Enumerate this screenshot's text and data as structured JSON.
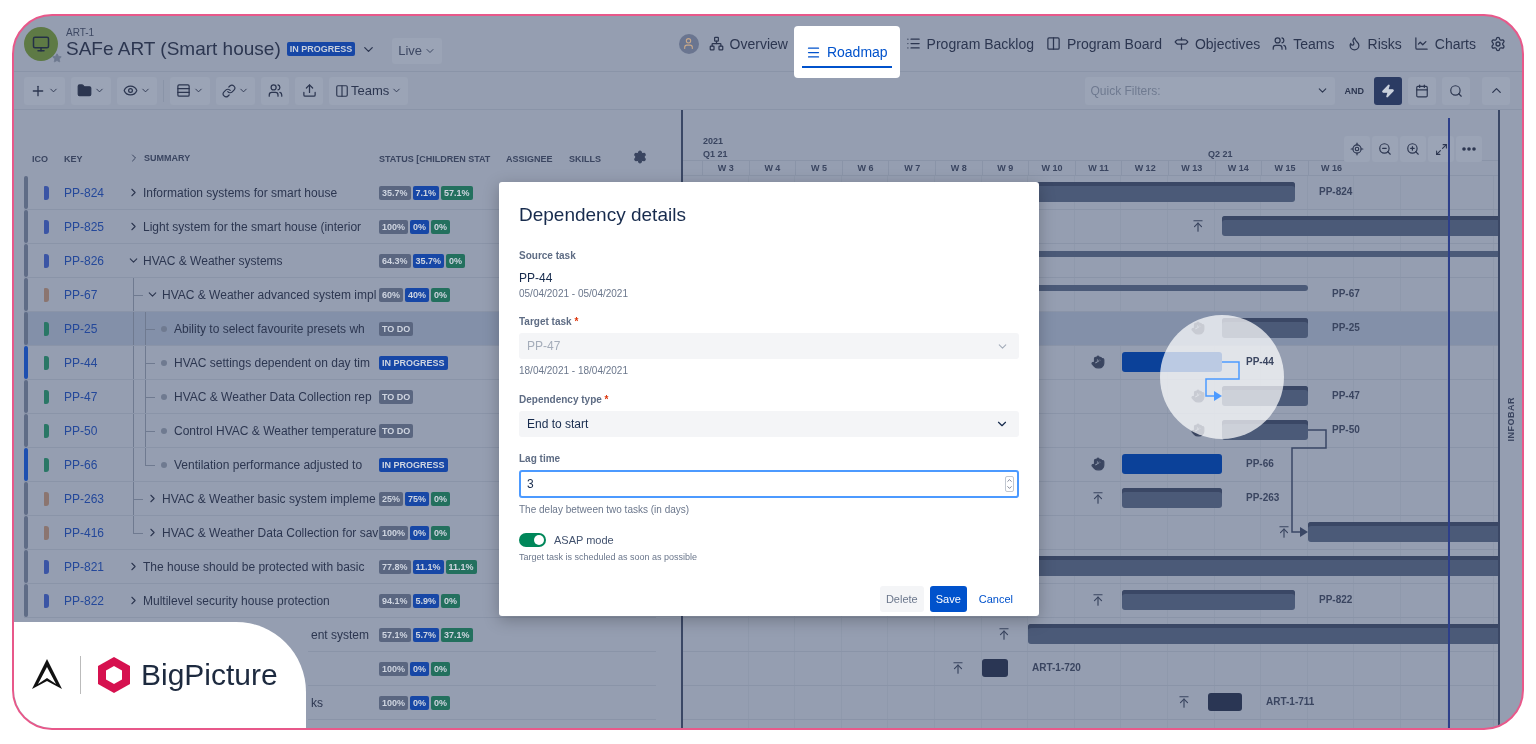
{
  "header": {
    "project_key": "ART-1",
    "title": "SAFe ART (Smart house)",
    "status": "IN PROGRESS",
    "view": "Live"
  },
  "nav": [
    {
      "label": "Overview",
      "selected": false
    },
    {
      "label": "Roadmap",
      "selected": true
    },
    {
      "label": "Program Backlog",
      "selected": false
    },
    {
      "label": "Program Board",
      "selected": false
    },
    {
      "label": "Objectives",
      "selected": false
    },
    {
      "label": "Teams",
      "selected": false
    },
    {
      "label": "Risks",
      "selected": false
    },
    {
      "label": "Charts",
      "selected": false
    }
  ],
  "toolbar": {
    "columns_button": "Teams",
    "quick_filters": {
      "placeholder": "Quick Filters:"
    },
    "operator": "AND",
    "lightning_active": true
  },
  "table": {
    "columns": [
      "ICO",
      "KEY",
      "SUMMARY",
      "STATUS [CHILDREN STAT",
      "ASSIGNEE",
      "SKILLS"
    ],
    "rows": [
      {
        "key": "PP-824",
        "summary": "Information systems for smart house",
        "color": "#3b55a5",
        "expanded": false,
        "selected": false,
        "status": [
          {
            "text": "35.7%",
            "kind": "todo"
          },
          {
            "text": "7.1%",
            "kind": "progress"
          },
          {
            "text": "57.1%",
            "kind": "done"
          }
        ],
        "bar": {
          "kind": "task",
          "label": "PP-824"
        }
      },
      {
        "key": "PP-825",
        "summary": "Light system for the smart house (interior",
        "color": "#3b55a5",
        "expanded": false,
        "selected": false,
        "status": [
          {
            "text": "100%",
            "kind": "todo"
          },
          {
            "text": "0%",
            "kind": "progress"
          },
          {
            "text": "0%",
            "kind": "done"
          }
        ],
        "bar": {
          "kind": "task",
          "marker": {
            "kind": "upload"
          }
        }
      },
      {
        "key": "PP-826",
        "summary": "HVAC & Weather systems",
        "color": "#3b55a5",
        "expanded": true,
        "selected": false,
        "status": [
          {
            "text": "64.3%",
            "kind": "todo"
          },
          {
            "text": "35.7%",
            "kind": "progress"
          },
          {
            "text": "0%",
            "kind": "done"
          }
        ],
        "bar": {
          "kind": "summary"
        },
        "children": [
          {
            "key": "PP-67",
            "summary": "HVAC & Weather advanced system impl",
            "color": "#8b7570",
            "expanded": true,
            "selected": false,
            "status": [
              {
                "text": "60%",
                "kind": "todo"
              },
              {
                "text": "40%",
                "kind": "progress"
              },
              {
                "text": "0%",
                "kind": "done"
              }
            ],
            "bar": {
              "kind": "summary",
              "label": "PP-67"
            },
            "children": [
              {
                "key": "PP-25",
                "summary": "Ability to select favourite presets wh",
                "color": "#2a7766",
                "selected": true,
                "status": [
                  {
                    "text": "TO DO",
                    "kind": "todo"
                  }
                ],
                "bar": {
                  "kind": "task",
                  "marker": {
                    "kind": "hand"
                  },
                  "label": "PP-25"
                }
              },
              {
                "key": "PP-44",
                "summary": "HVAC settings dependent on day tim",
                "color": "#2a7766",
                "selected": false,
                "status": [
                  {
                    "text": "IN PROGRESS",
                    "kind": "progress"
                  }
                ],
                "bar": {
                  "kind": "active",
                  "marker": {
                    "kind": "hand"
                  },
                  "label": "PP-44"
                }
              },
              {
                "key": "PP-47",
                "summary": "HVAC & Weather Data Collection rep",
                "color": "#2a7766",
                "selected": false,
                "status": [
                  {
                    "text": "TO DO",
                    "kind": "todo"
                  }
                ],
                "bar": {
                  "kind": "task",
                  "marker": {
                    "kind": "hand"
                  },
                  "label": "PP-47"
                }
              },
              {
                "key": "PP-50",
                "summary": "Control HVAC & Weather temperature",
                "color": "#2a7766",
                "selected": false,
                "status": [
                  {
                    "text": "TO DO",
                    "kind": "todo"
                  }
                ],
                "bar": {
                  "kind": "task",
                  "marker": {
                    "kind": "hand"
                  },
                  "label": "PP-50"
                }
              },
              {
                "key": "PP-66",
                "summary": "Ventilation performance adjusted to",
                "color": "#2a7766",
                "selected": false,
                "status": [
                  {
                    "text": "IN PROGRESS",
                    "kind": "progress"
                  }
                ],
                "bar": {
                  "kind": "active",
                  "marker": {
                    "kind": "hand"
                  },
                  "label": "PP-66"
                }
              }
            ]
          },
          {
            "key": "PP-263",
            "summary": "HVAC & Weather basic system impleme",
            "color": "#8b7570",
            "expanded": false,
            "selected": false,
            "status": [
              {
                "text": "25%",
                "kind": "todo"
              },
              {
                "text": "75%",
                "kind": "progress"
              },
              {
                "text": "0%",
                "kind": "done"
              }
            ],
            "bar": {
              "kind": "task",
              "marker": {
                "kind": "upload"
              },
              "label": "PP-263"
            }
          },
          {
            "key": "PP-416",
            "summary": "HVAC & Weather Data Collection for sav",
            "color": "#8b7570",
            "expanded": false,
            "selected": false,
            "status": [
              {
                "text": "100%",
                "kind": "todo"
              },
              {
                "text": "0%",
                "kind": "progress"
              },
              {
                "text": "0%",
                "kind": "done"
              }
            ],
            "bar": {
              "kind": "task",
              "marker": {
                "kind": "upload"
              }
            }
          }
        ]
      },
      {
        "key": "PP-821",
        "summary": "The house should be protected with basic",
        "color": "#3b55a5",
        "expanded": false,
        "selected": false,
        "status": [
          {
            "text": "77.8%",
            "kind": "todo"
          },
          {
            "text": "11.1%",
            "kind": "progress"
          },
          {
            "text": "11.1%",
            "kind": "done"
          }
        ],
        "bar": {
          "kind": "task"
        }
      },
      {
        "key": "PP-822",
        "summary": "Multilevel security house protection",
        "color": "#3b55a5",
        "expanded": false,
        "selected": false,
        "status": [
          {
            "text": "94.1%",
            "kind": "todo"
          },
          {
            "text": "5.9%",
            "kind": "progress"
          },
          {
            "text": "0%",
            "kind": "done"
          }
        ],
        "bar": {
          "kind": "task",
          "marker": {
            "kind": "upload"
          },
          "label": "PP-822"
        }
      },
      {
        "summary": "ent system",
        "selected": false,
        "status": [
          {
            "text": "57.1%",
            "kind": "todo"
          },
          {
            "text": "5.7%",
            "kind": "progress"
          },
          {
            "text": "37.1%",
            "kind": "done"
          }
        ],
        "bar": {
          "kind": "task",
          "marker": {
            "kind": "upload"
          }
        }
      },
      {
        "selected": false,
        "status": [
          {
            "text": "100%",
            "kind": "todo"
          },
          {
            "text": "0%",
            "kind": "progress"
          },
          {
            "text": "0%",
            "kind": "done"
          }
        ],
        "bar": {
          "kind": "compact",
          "marker": {
            "kind": "upload"
          },
          "label": "ART-1-720"
        }
      },
      {
        "summary": "ks",
        "selected": false,
        "status": [
          {
            "text": "100%",
            "kind": "todo"
          },
          {
            "text": "0%",
            "kind": "progress"
          },
          {
            "text": "0%",
            "kind": "done"
          }
        ],
        "bar": {
          "kind": "compact",
          "marker": {
            "kind": "upload"
          },
          "label": "ART-1-711"
        }
      }
    ]
  },
  "gantt": {
    "year": "2021",
    "quarters": [
      "Q1 21",
      "Q2 21"
    ],
    "weeks": [
      "W 3",
      "W 4",
      "W 5",
      "W 6",
      "W 7",
      "W 8",
      "W 9",
      "W 10",
      "W 11",
      "W 12",
      "W 13",
      "W 14",
      "W 15",
      "W 16"
    ]
  },
  "infobar": "INFOBAR",
  "dialog": {
    "title": "Dependency details",
    "source": {
      "label": "Source task",
      "key": "PP-44",
      "dates": "05/04/2021 - 05/04/2021"
    },
    "target": {
      "label": "Target task",
      "required_mark": "*",
      "value": "PP-47",
      "disabled": true,
      "dates": "18/04/2021 - 18/04/2021"
    },
    "type": {
      "label": "Dependency type",
      "required_mark": "*",
      "value": "End to start"
    },
    "lag": {
      "label": "Lag time",
      "value": "3",
      "help": "The delay between two tasks (in days)"
    },
    "asap": {
      "label": "ASAP mode",
      "on": true,
      "help": "Target task is scheduled as soon as possible"
    },
    "buttons": [
      {
        "label": "Delete",
        "kind": "secondary"
      },
      {
        "label": "Save",
        "kind": "primary"
      },
      {
        "label": "Cancel",
        "kind": "link"
      }
    ]
  },
  "brand": "BigPicture"
}
